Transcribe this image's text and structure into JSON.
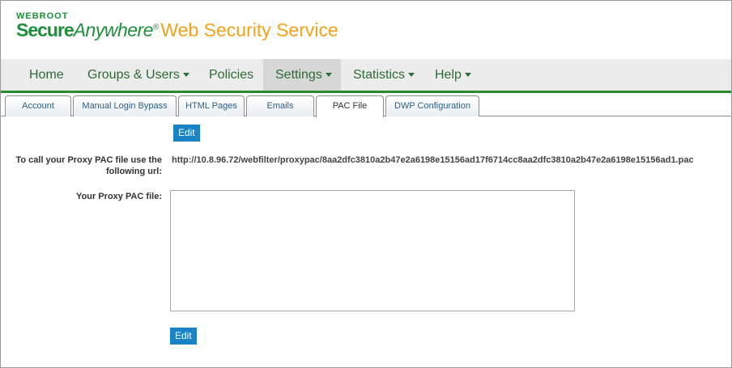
{
  "logo": {
    "brand_small": "WEBROOT",
    "secure": "Secure",
    "anywhere": "Anywhere",
    "reg": "®",
    "service": "Web Security Service"
  },
  "colors": {
    "brand_green": "#1d8f3a",
    "brand_orange": "#f5a21b",
    "nav_underline": "#2a8a2e",
    "button_blue": "#1a83c6"
  },
  "nav": {
    "items": [
      {
        "label": "Home",
        "dropdown": false,
        "active": false
      },
      {
        "label": "Groups & Users",
        "dropdown": true,
        "active": false
      },
      {
        "label": "Policies",
        "dropdown": false,
        "active": false
      },
      {
        "label": "Settings",
        "dropdown": true,
        "active": true
      },
      {
        "label": "Statistics",
        "dropdown": true,
        "active": false
      },
      {
        "label": "Help",
        "dropdown": true,
        "active": false
      }
    ]
  },
  "subtabs": [
    {
      "label": "Account",
      "active": false
    },
    {
      "label": "Manual Login Bypass",
      "active": false
    },
    {
      "label": "HTML Pages",
      "active": false
    },
    {
      "label": "Emails",
      "active": false
    },
    {
      "label": "PAC File",
      "active": true
    },
    {
      "label": "DWP Configuration",
      "active": false
    }
  ],
  "content": {
    "edit_top_label": "Edit",
    "url_label": "To call your Proxy PAC file use the following url:",
    "url_value": "http://10.8.96.72/webfilter/proxypac/8aa2dfc3810a2b47e2a6198e15156ad17f6714cc8aa2dfc3810a2b47e2a6198e15156ad1.pac",
    "pac_label": "Your Proxy PAC file:",
    "pac_value": "",
    "edit_bottom_label": "Edit"
  }
}
